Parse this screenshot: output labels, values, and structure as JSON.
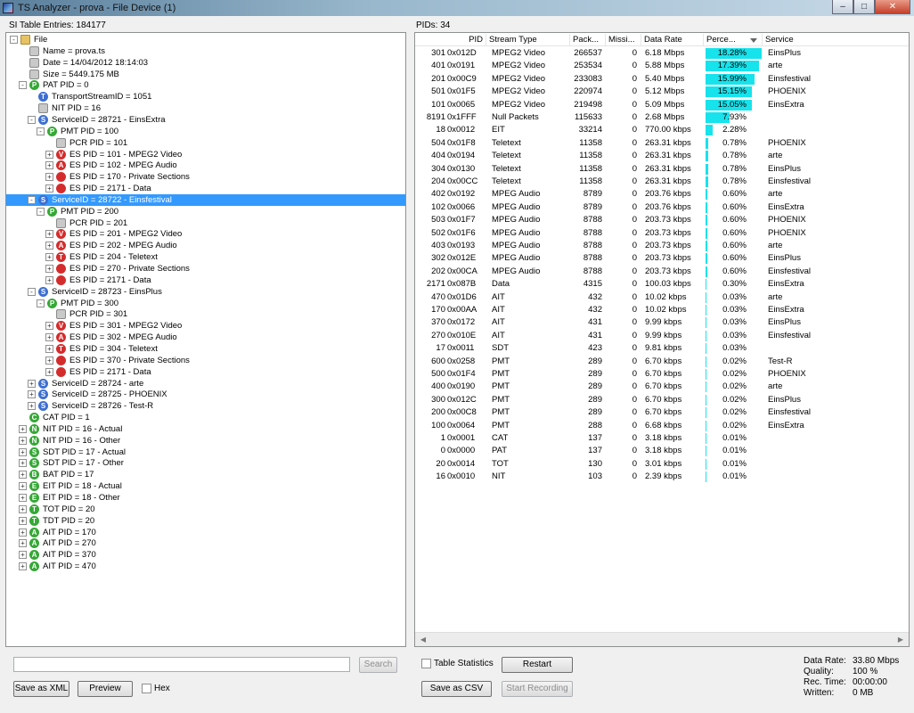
{
  "window": {
    "title": "TS Analyzer - prova - File Device (1)",
    "minimize": "–",
    "maximize": "□",
    "close": "✕"
  },
  "si_table_label": "SI Table Entries: 184177",
  "pids_label": "PIDs: 34",
  "tree": [
    {
      "depth": 0,
      "exp": "-",
      "icon": "folder",
      "text": "File"
    },
    {
      "depth": 1,
      "exp": "",
      "icon": "gray",
      "text": "Name = prova.ts"
    },
    {
      "depth": 1,
      "exp": "",
      "icon": "gray",
      "text": "Date = 14/04/2012 18:14:03"
    },
    {
      "depth": 1,
      "exp": "",
      "icon": "gray",
      "text": "Size = 5449.175 MB"
    },
    {
      "depth": 1,
      "exp": "-",
      "icon": "green",
      "letter": "P",
      "text": "PAT PID = 0"
    },
    {
      "depth": 2,
      "exp": "",
      "icon": "blue",
      "letter": "T",
      "text": "TransportStreamID = 1051"
    },
    {
      "depth": 2,
      "exp": "",
      "icon": "gray",
      "text": "NIT PID = 16"
    },
    {
      "depth": 2,
      "exp": "-",
      "icon": "blue",
      "letter": "S",
      "text": "ServiceID = 28721 - EinsExtra"
    },
    {
      "depth": 3,
      "exp": "-",
      "icon": "green",
      "letter": "P",
      "text": "PMT PID = 100"
    },
    {
      "depth": 4,
      "exp": "",
      "icon": "gray",
      "text": "PCR PID = 101"
    },
    {
      "depth": 4,
      "exp": "+",
      "icon": "red",
      "letter": "V",
      "text": "ES PID = 101 - MPEG2 Video"
    },
    {
      "depth": 4,
      "exp": "+",
      "icon": "red",
      "letter": "A",
      "text": "ES PID = 102 - MPEG Audio"
    },
    {
      "depth": 4,
      "exp": "+",
      "icon": "red",
      "letter": "",
      "text": "ES PID = 170 - Private Sections"
    },
    {
      "depth": 4,
      "exp": "+",
      "icon": "red",
      "letter": "",
      "text": "ES PID = 2171 - Data"
    },
    {
      "depth": 2,
      "exp": "-",
      "icon": "blue",
      "letter": "S",
      "text": "ServiceID = 28722 - Einsfestival",
      "selected": true
    },
    {
      "depth": 3,
      "exp": "-",
      "icon": "green",
      "letter": "P",
      "text": "PMT PID = 200"
    },
    {
      "depth": 4,
      "exp": "",
      "icon": "gray",
      "text": "PCR PID = 201"
    },
    {
      "depth": 4,
      "exp": "+",
      "icon": "red",
      "letter": "V",
      "text": "ES PID = 201 - MPEG2 Video"
    },
    {
      "depth": 4,
      "exp": "+",
      "icon": "red",
      "letter": "A",
      "text": "ES PID = 202 - MPEG Audio"
    },
    {
      "depth": 4,
      "exp": "+",
      "icon": "red",
      "letter": "T",
      "text": "ES PID = 204 - Teletext"
    },
    {
      "depth": 4,
      "exp": "+",
      "icon": "red",
      "letter": "",
      "text": "ES PID = 270 - Private Sections"
    },
    {
      "depth": 4,
      "exp": "+",
      "icon": "red",
      "letter": "",
      "text": "ES PID = 2171 - Data"
    },
    {
      "depth": 2,
      "exp": "-",
      "icon": "blue",
      "letter": "S",
      "text": "ServiceID = 28723 - EinsPlus"
    },
    {
      "depth": 3,
      "exp": "-",
      "icon": "green",
      "letter": "P",
      "text": "PMT PID = 300"
    },
    {
      "depth": 4,
      "exp": "",
      "icon": "gray",
      "text": "PCR PID = 301"
    },
    {
      "depth": 4,
      "exp": "+",
      "icon": "red",
      "letter": "V",
      "text": "ES PID = 301 - MPEG2 Video"
    },
    {
      "depth": 4,
      "exp": "+",
      "icon": "red",
      "letter": "A",
      "text": "ES PID = 302 - MPEG Audio"
    },
    {
      "depth": 4,
      "exp": "+",
      "icon": "red",
      "letter": "T",
      "text": "ES PID = 304 - Teletext"
    },
    {
      "depth": 4,
      "exp": "+",
      "icon": "red",
      "letter": "",
      "text": "ES PID = 370 - Private Sections"
    },
    {
      "depth": 4,
      "exp": "+",
      "icon": "red",
      "letter": "",
      "text": "ES PID = 2171 - Data"
    },
    {
      "depth": 2,
      "exp": "+",
      "icon": "blue",
      "letter": "S",
      "text": "ServiceID = 28724 - arte"
    },
    {
      "depth": 2,
      "exp": "+",
      "icon": "blue",
      "letter": "S",
      "text": "ServiceID = 28725 - PHOENIX"
    },
    {
      "depth": 2,
      "exp": "+",
      "icon": "blue",
      "letter": "S",
      "text": "ServiceID = 28726 - Test-R"
    },
    {
      "depth": 1,
      "exp": "",
      "icon": "green",
      "letter": "C",
      "text": "CAT PID = 1"
    },
    {
      "depth": 1,
      "exp": "+",
      "icon": "green",
      "letter": "N",
      "text": "NIT PID = 16 - Actual"
    },
    {
      "depth": 1,
      "exp": "+",
      "icon": "green",
      "letter": "N",
      "text": "NIT PID = 16 - Other"
    },
    {
      "depth": 1,
      "exp": "+",
      "icon": "green",
      "letter": "S",
      "text": "SDT PID = 17 - Actual"
    },
    {
      "depth": 1,
      "exp": "+",
      "icon": "green",
      "letter": "S",
      "text": "SDT PID = 17 - Other"
    },
    {
      "depth": 1,
      "exp": "+",
      "icon": "green",
      "letter": "B",
      "text": "BAT PID = 17"
    },
    {
      "depth": 1,
      "exp": "+",
      "icon": "green",
      "letter": "E",
      "text": "EIT PID = 18 - Actual"
    },
    {
      "depth": 1,
      "exp": "+",
      "icon": "green",
      "letter": "E",
      "text": "EIT PID = 18 - Other"
    },
    {
      "depth": 1,
      "exp": "+",
      "icon": "green",
      "letter": "T",
      "text": "TOT PID = 20"
    },
    {
      "depth": 1,
      "exp": "+",
      "icon": "green",
      "letter": "T",
      "text": "TDT PID = 20"
    },
    {
      "depth": 1,
      "exp": "+",
      "icon": "green",
      "letter": "A",
      "text": "AIT PID = 170"
    },
    {
      "depth": 1,
      "exp": "+",
      "icon": "green",
      "letter": "A",
      "text": "AIT PID = 270"
    },
    {
      "depth": 1,
      "exp": "+",
      "icon": "green",
      "letter": "A",
      "text": "AIT PID = 370"
    },
    {
      "depth": 1,
      "exp": "+",
      "icon": "green",
      "letter": "A",
      "text": "AIT PID = 470"
    }
  ],
  "table": {
    "columns": [
      "PID",
      "Stream Type",
      "Pack...",
      "Missi...",
      "Data Rate",
      "Perce...",
      "Service"
    ],
    "rows": [
      {
        "pid": "301",
        "hex": "0x012D",
        "type": "MPEG2 Video",
        "packets": "266537",
        "missing": "0",
        "rate": "6.18 Mbps",
        "pct": "18.28%",
        "pctval": 18.28,
        "service": "EinsPlus"
      },
      {
        "pid": "401",
        "hex": "0x0191",
        "type": "MPEG2 Video",
        "packets": "253534",
        "missing": "0",
        "rate": "5.88 Mbps",
        "pct": "17.39%",
        "pctval": 17.39,
        "service": "arte"
      },
      {
        "pid": "201",
        "hex": "0x00C9",
        "type": "MPEG2 Video",
        "packets": "233083",
        "missing": "0",
        "rate": "5.40 Mbps",
        "pct": "15.99%",
        "pctval": 15.99,
        "service": "Einsfestival"
      },
      {
        "pid": "501",
        "hex": "0x01F5",
        "type": "MPEG2 Video",
        "packets": "220974",
        "missing": "0",
        "rate": "5.12 Mbps",
        "pct": "15.15%",
        "pctval": 15.15,
        "service": "PHOENIX"
      },
      {
        "pid": "101",
        "hex": "0x0065",
        "type": "MPEG2 Video",
        "packets": "219498",
        "missing": "0",
        "rate": "5.09 Mbps",
        "pct": "15.05%",
        "pctval": 15.05,
        "service": "EinsExtra"
      },
      {
        "pid": "8191",
        "hex": "0x1FFF",
        "type": "Null Packets",
        "packets": "115633",
        "missing": "0",
        "rate": "2.68 Mbps",
        "pct": "7.93%",
        "pctval": 7.93,
        "service": ""
      },
      {
        "pid": "18",
        "hex": "0x0012",
        "type": "EIT",
        "packets": "33214",
        "missing": "0",
        "rate": "770.00 kbps",
        "pct": "2.28%",
        "pctval": 2.28,
        "service": ""
      },
      {
        "pid": "504",
        "hex": "0x01F8",
        "type": "Teletext",
        "packets": "11358",
        "missing": "0",
        "rate": "263.31 kbps",
        "pct": "0.78%",
        "pctval": 0.78,
        "service": "PHOENIX"
      },
      {
        "pid": "404",
        "hex": "0x0194",
        "type": "Teletext",
        "packets": "11358",
        "missing": "0",
        "rate": "263.31 kbps",
        "pct": "0.78%",
        "pctval": 0.78,
        "service": "arte"
      },
      {
        "pid": "304",
        "hex": "0x0130",
        "type": "Teletext",
        "packets": "11358",
        "missing": "0",
        "rate": "263.31 kbps",
        "pct": "0.78%",
        "pctval": 0.78,
        "service": "EinsPlus"
      },
      {
        "pid": "204",
        "hex": "0x00CC",
        "type": "Teletext",
        "packets": "11358",
        "missing": "0",
        "rate": "263.31 kbps",
        "pct": "0.78%",
        "pctval": 0.78,
        "service": "Einsfestival"
      },
      {
        "pid": "402",
        "hex": "0x0192",
        "type": "MPEG Audio",
        "packets": "8789",
        "missing": "0",
        "rate": "203.76 kbps",
        "pct": "0.60%",
        "pctval": 0.6,
        "service": "arte"
      },
      {
        "pid": "102",
        "hex": "0x0066",
        "type": "MPEG Audio",
        "packets": "8789",
        "missing": "0",
        "rate": "203.76 kbps",
        "pct": "0.60%",
        "pctval": 0.6,
        "service": "EinsExtra"
      },
      {
        "pid": "503",
        "hex": "0x01F7",
        "type": "MPEG Audio",
        "packets": "8788",
        "missing": "0",
        "rate": "203.73 kbps",
        "pct": "0.60%",
        "pctval": 0.6,
        "service": "PHOENIX"
      },
      {
        "pid": "502",
        "hex": "0x01F6",
        "type": "MPEG Audio",
        "packets": "8788",
        "missing": "0",
        "rate": "203.73 kbps",
        "pct": "0.60%",
        "pctval": 0.6,
        "service": "PHOENIX"
      },
      {
        "pid": "403",
        "hex": "0x0193",
        "type": "MPEG Audio",
        "packets": "8788",
        "missing": "0",
        "rate": "203.73 kbps",
        "pct": "0.60%",
        "pctval": 0.6,
        "service": "arte"
      },
      {
        "pid": "302",
        "hex": "0x012E",
        "type": "MPEG Audio",
        "packets": "8788",
        "missing": "0",
        "rate": "203.73 kbps",
        "pct": "0.60%",
        "pctval": 0.6,
        "service": "EinsPlus"
      },
      {
        "pid": "202",
        "hex": "0x00CA",
        "type": "MPEG Audio",
        "packets": "8788",
        "missing": "0",
        "rate": "203.73 kbps",
        "pct": "0.60%",
        "pctval": 0.6,
        "service": "Einsfestival"
      },
      {
        "pid": "2171",
        "hex": "0x087B",
        "type": "Data",
        "packets": "4315",
        "missing": "0",
        "rate": "100.03 kbps",
        "pct": "0.30%",
        "pctval": 0.3,
        "service": "EinsExtra"
      },
      {
        "pid": "470",
        "hex": "0x01D6",
        "type": "AIT",
        "packets": "432",
        "missing": "0",
        "rate": "10.02 kbps",
        "pct": "0.03%",
        "pctval": 0.03,
        "service": "arte"
      },
      {
        "pid": "170",
        "hex": "0x00AA",
        "type": "AIT",
        "packets": "432",
        "missing": "0",
        "rate": "10.02 kbps",
        "pct": "0.03%",
        "pctval": 0.03,
        "service": "EinsExtra"
      },
      {
        "pid": "370",
        "hex": "0x0172",
        "type": "AIT",
        "packets": "431",
        "missing": "0",
        "rate": "9.99 kbps",
        "pct": "0.03%",
        "pctval": 0.03,
        "service": "EinsPlus"
      },
      {
        "pid": "270",
        "hex": "0x010E",
        "type": "AIT",
        "packets": "431",
        "missing": "0",
        "rate": "9.99 kbps",
        "pct": "0.03%",
        "pctval": 0.03,
        "service": "Einsfestival"
      },
      {
        "pid": "17",
        "hex": "0x0011",
        "type": "SDT",
        "packets": "423",
        "missing": "0",
        "rate": "9.81 kbps",
        "pct": "0.03%",
        "pctval": 0.03,
        "service": ""
      },
      {
        "pid": "600",
        "hex": "0x0258",
        "type": "PMT",
        "packets": "289",
        "missing": "0",
        "rate": "6.70 kbps",
        "pct": "0.02%",
        "pctval": 0.02,
        "service": "Test-R"
      },
      {
        "pid": "500",
        "hex": "0x01F4",
        "type": "PMT",
        "packets": "289",
        "missing": "0",
        "rate": "6.70 kbps",
        "pct": "0.02%",
        "pctval": 0.02,
        "service": "PHOENIX"
      },
      {
        "pid": "400",
        "hex": "0x0190",
        "type": "PMT",
        "packets": "289",
        "missing": "0",
        "rate": "6.70 kbps",
        "pct": "0.02%",
        "pctval": 0.02,
        "service": "arte"
      },
      {
        "pid": "300",
        "hex": "0x012C",
        "type": "PMT",
        "packets": "289",
        "missing": "0",
        "rate": "6.70 kbps",
        "pct": "0.02%",
        "pctval": 0.02,
        "service": "EinsPlus"
      },
      {
        "pid": "200",
        "hex": "0x00C8",
        "type": "PMT",
        "packets": "289",
        "missing": "0",
        "rate": "6.70 kbps",
        "pct": "0.02%",
        "pctval": 0.02,
        "service": "Einsfestival"
      },
      {
        "pid": "100",
        "hex": "0x0064",
        "type": "PMT",
        "packets": "288",
        "missing": "0",
        "rate": "6.68 kbps",
        "pct": "0.02%",
        "pctval": 0.02,
        "service": "EinsExtra"
      },
      {
        "pid": "1",
        "hex": "0x0001",
        "type": "CAT",
        "packets": "137",
        "missing": "0",
        "rate": "3.18 kbps",
        "pct": "0.01%",
        "pctval": 0.01,
        "service": ""
      },
      {
        "pid": "0",
        "hex": "0x0000",
        "type": "PAT",
        "packets": "137",
        "missing": "0",
        "rate": "3.18 kbps",
        "pct": "0.01%",
        "pctval": 0.01,
        "service": ""
      },
      {
        "pid": "20",
        "hex": "0x0014",
        "type": "TOT",
        "packets": "130",
        "missing": "0",
        "rate": "3.01 kbps",
        "pct": "0.01%",
        "pctval": 0.01,
        "service": ""
      },
      {
        "pid": "16",
        "hex": "0x0010",
        "type": "NIT",
        "packets": "103",
        "missing": "0",
        "rate": "2.39 kbps",
        "pct": "0.01%",
        "pctval": 0.01,
        "service": ""
      }
    ],
    "bar_color": "#17e3ec"
  },
  "controls": {
    "search_button": "Search",
    "search_placeholder": "",
    "save_xml": "Save as XML",
    "preview": "Preview",
    "hex_label": "Hex",
    "table_statistics_label": "Table Statistics",
    "restart": "Restart",
    "save_csv": "Save as CSV",
    "start_recording": "Start Recording"
  },
  "stats": {
    "data_rate_label": "Data Rate:",
    "data_rate_value": "33.80 Mbps",
    "quality_label": "Quality:",
    "quality_value": "100 %",
    "rec_time_label": "Rec. Time:",
    "rec_time_value": "00:00:00",
    "written_label": "Written:",
    "written_value": "0 MB"
  },
  "colors": {
    "selection": "#3399ff"
  }
}
